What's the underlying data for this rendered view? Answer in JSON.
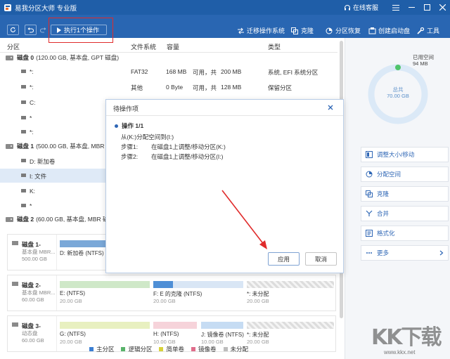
{
  "titlebar": {
    "title": "易我分区大师 专业版",
    "support": "在线客服"
  },
  "toolbar": {
    "execute_label": "执行1个操作",
    "migrate_label": "迁移操作系统",
    "clone_label": "克隆",
    "recover_label": "分区恢复",
    "bootdisk_label": "创建启动盘",
    "tools_label": "工具"
  },
  "columns": {
    "partition": "分区",
    "filesystem": "文件系统",
    "capacity": "容量",
    "type": "类型"
  },
  "disks": [
    {
      "name": "磁盘 0",
      "info": "(120.00 GB, 基本盘, GPT 磁盘)"
    },
    {
      "name": "磁盘 1",
      "info": "(500.00 GB, 基本盘, MBR 磁盘)"
    },
    {
      "name": "磁盘 2",
      "info": "(60.00 GB, 基本盘, MBR 磁盘)"
    }
  ],
  "partitions": [
    {
      "name": "*:",
      "fs": "FAT32",
      "cap": "168 MB",
      "free_lbl": "可用，共",
      "total": "200 MB",
      "type": "系统, EFI 系统分区"
    },
    {
      "name": "*:",
      "fs": "其他",
      "cap": "0 Byte",
      "free_lbl": "可用，共",
      "total": "128 MB",
      "type": "保留分区"
    },
    {
      "name": "C:",
      "fs": "",
      "cap": "",
      "free_lbl": "",
      "total": "",
      "type": ""
    },
    {
      "name": "*",
      "fs": "",
      "cap": "",
      "free_lbl": "",
      "total": "",
      "type": ""
    },
    {
      "name": "*:",
      "fs": "",
      "cap": "",
      "free_lbl": "",
      "total": "",
      "type": ""
    },
    {
      "name": "D: 新加卷",
      "fs": "",
      "cap": "",
      "free_lbl": "",
      "total": "",
      "type": ""
    },
    {
      "name": "I: 文件",
      "fs": "",
      "cap": "",
      "free_lbl": "",
      "total": "",
      "type": ""
    },
    {
      "name": "K:",
      "fs": "",
      "cap": "",
      "free_lbl": "",
      "total": "",
      "type": ""
    },
    {
      "name": "*",
      "fs": "",
      "cap": "",
      "free_lbl": "",
      "total": "",
      "type": ""
    }
  ],
  "diskmap": [
    {
      "name": "磁盘 1-",
      "type": "基本盘 MBR...",
      "size": "500.00 GB",
      "segs": [
        {
          "label": "D: 新加卷 (NTFS)",
          "size": "",
          "color": "#7aa8d8"
        }
      ]
    },
    {
      "name": "磁盘 2-",
      "type": "基本盘 MBR...",
      "size": "60.00 GB",
      "segs": [
        {
          "label": "E: (NTFS)",
          "size": "20.00 GB",
          "color": "#cfe8c8"
        },
        {
          "label": "F: E 的克隆 (NTFS)",
          "size": "20.00 GB",
          "color": "#4f8fd6"
        },
        {
          "label": "*: 未分配",
          "size": "20.00 GB",
          "color": "#e0e0e0"
        }
      ]
    },
    {
      "name": "磁盘 3-",
      "type": "动态盘",
      "size": "60.00 GB",
      "segs": [
        {
          "label": "G: (NTFS)",
          "size": "20.00 GB",
          "color": "#e8f0c0"
        },
        {
          "label": "H: (NTFS)",
          "size": "10.00 GB",
          "color": "#f6d3da"
        },
        {
          "label": "J: 镜像卷 (NTFS)",
          "size": "10.00 GB",
          "color": "#c6dcf3"
        },
        {
          "label": "*: 未分配",
          "size": "20.00 GB",
          "color": "#e0e0e0"
        }
      ]
    }
  ],
  "legend": [
    {
      "label": "主分区",
      "color": "#3b7fd3"
    },
    {
      "label": "逻辑分区",
      "color": "#59b36a"
    },
    {
      "label": "简单卷",
      "color": "#d8d23a"
    },
    {
      "label": "镜像卷",
      "color": "#e06d8b"
    },
    {
      "label": "未分配",
      "color": "#bdbdbd"
    }
  ],
  "rightpanel": {
    "used_label": "已用空间",
    "used_value": "94 MB",
    "total_label": "总共",
    "total_value": "70.00 GB",
    "used_fraction": 0.0013,
    "actions": [
      {
        "label": "调整大小/移动"
      },
      {
        "label": "分配空间"
      },
      {
        "label": "克隆"
      },
      {
        "label": "合并"
      },
      {
        "label": "格式化"
      },
      {
        "label": "更多"
      }
    ]
  },
  "dialog": {
    "title": "待操作项",
    "op_header": "操作 1/1",
    "op_desc": "从(K:)分配空间到(I:)",
    "step1_label": "步骤1:",
    "step1_text": "在磁盘1上调整/移动分区(K:)",
    "step2_label": "步骤2:",
    "step2_text": "在磁盘1上调整/移动分区(I:)",
    "apply_label": "应用",
    "cancel_label": "取消"
  },
  "watermark": {
    "brand": "KK下载",
    "url": "www.kkx.net"
  },
  "colors": {
    "titlebar": "#1f5ea8",
    "toolbar": "#2966b2",
    "accent": "#2e66b5",
    "highlight_box": "#e02b2b",
    "donut_used": "#4fc46b",
    "donut_ring": "#dbe9f7"
  }
}
